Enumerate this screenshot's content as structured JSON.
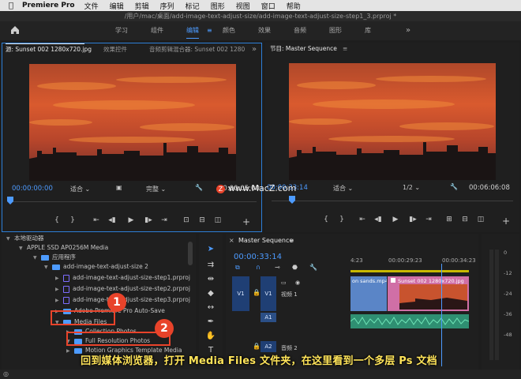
{
  "menubar": {
    "app_name": "Premiere Pro",
    "items": [
      "文件",
      "编辑",
      "剪辑",
      "序列",
      "标记",
      "图形",
      "视图",
      "窗口",
      "帮助"
    ]
  },
  "window": {
    "title": "/用户/mac/桌面/add-image-text-adjust-size/add-image-text-adjust-size-step1_3.prproj *"
  },
  "workspaces": {
    "items": [
      "学习",
      "组件",
      "编辑",
      "颜色",
      "效果",
      "音频",
      "图形",
      "库"
    ],
    "active": "编辑",
    "more": "»"
  },
  "source_panel": {
    "tabs": [
      "源: Sunset 002 1280x720.jpg",
      "效果控件",
      "音频剪辑混合器: Sunset 002 1280"
    ],
    "more": "»",
    "timecode": "00:00:00:00",
    "fit": "适合",
    "quality": "完整",
    "duration": "00:00:05:00"
  },
  "program_panel": {
    "tab": "节目: Master Sequence",
    "menu": "≡",
    "timecode": "00:00:33:14",
    "fit": "适合",
    "resolution": "1/2",
    "duration": "00:06:06:08"
  },
  "project_panel": {
    "rows": [
      {
        "label": "本地驱动器",
        "type": "root"
      },
      {
        "label": "APPLE SSD AP0256M Media",
        "type": "drive"
      },
      {
        "label": "应用程序",
        "type": "folder"
      },
      {
        "label": "add-image-text-adjust-size 2",
        "type": "folder"
      },
      {
        "label": "add-image-text-adjust-size-step1.prproj",
        "type": "file"
      },
      {
        "label": "add-image-text-adjust-size-step2.prproj",
        "type": "file"
      },
      {
        "label": "add-image-text-adjust-size-step3.prproj",
        "type": "file"
      },
      {
        "label": "Adobe Premiere Pro Auto-Save",
        "type": "folder"
      },
      {
        "label": "Media Files",
        "type": "folder"
      },
      {
        "label": "Collection Photos",
        "type": "folder"
      },
      {
        "label": "Full Resolution Photos",
        "type": "folder"
      },
      {
        "label": "Motion Graphics Template Media",
        "type": "folder"
      }
    ]
  },
  "timeline": {
    "tab": "Master Sequence",
    "menu": "≡",
    "timecode": "00:00:33:14",
    "ruler": [
      "4:23",
      "00:00:29:23",
      "00:00:34:23"
    ],
    "tracks": {
      "v1_src": "V1",
      "v1": "V1",
      "v1_name": "视频 1",
      "a1": "A1",
      "a2": "A2",
      "a2_name": "音频 2"
    },
    "clips": {
      "clip_a": "on sands.mp4",
      "clip_b": "Sunset 002 1280x720.jpg"
    }
  },
  "meter": {
    "labels": [
      "0",
      "-12",
      "-24",
      "-36",
      "-48"
    ]
  },
  "annotations": {
    "badge_1": "1",
    "badge_2": "2",
    "caption": "回到媒体浏览器，打开 Media Files 文件夹，在这里看到一个多层 Ps 文档",
    "watermark": "www.MacZ.com"
  },
  "colors": {
    "accent": "#4d9bff",
    "badge": "#e8432a",
    "caption": "#ffe45a"
  }
}
